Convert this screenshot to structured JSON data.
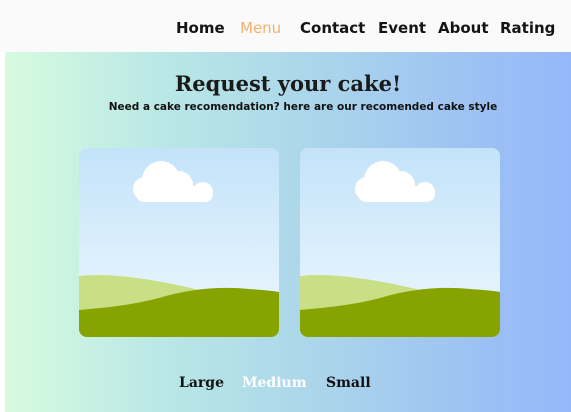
{
  "nav": {
    "items": [
      {
        "label": "Home"
      },
      {
        "label": "Menu",
        "active": true
      },
      {
        "label": "Contact"
      },
      {
        "label": "Event"
      },
      {
        "label": "About"
      },
      {
        "label": "Rating"
      }
    ]
  },
  "hero": {
    "title": "Request your cake!",
    "subtitle": "Need a cake recomendation? here are our recomended cake style"
  },
  "cards": [
    {
      "icon": "landscape-image-placeholder-icon"
    },
    {
      "icon": "landscape-image-placeholder-icon"
    }
  ],
  "sizes": {
    "options": [
      {
        "label": "Large"
      },
      {
        "label": "Medium",
        "active": true
      },
      {
        "label": "Small"
      }
    ]
  },
  "colors": {
    "accent": "#f4b16e",
    "text": "#141414",
    "grass_dark": "#86a300",
    "grass_light": "#c9df86",
    "sky_top": "#c3e3f9",
    "sky_bottom": "#eef8ff",
    "gradient_left": "#d6fbe0",
    "gradient_right": "#94b8fb"
  }
}
